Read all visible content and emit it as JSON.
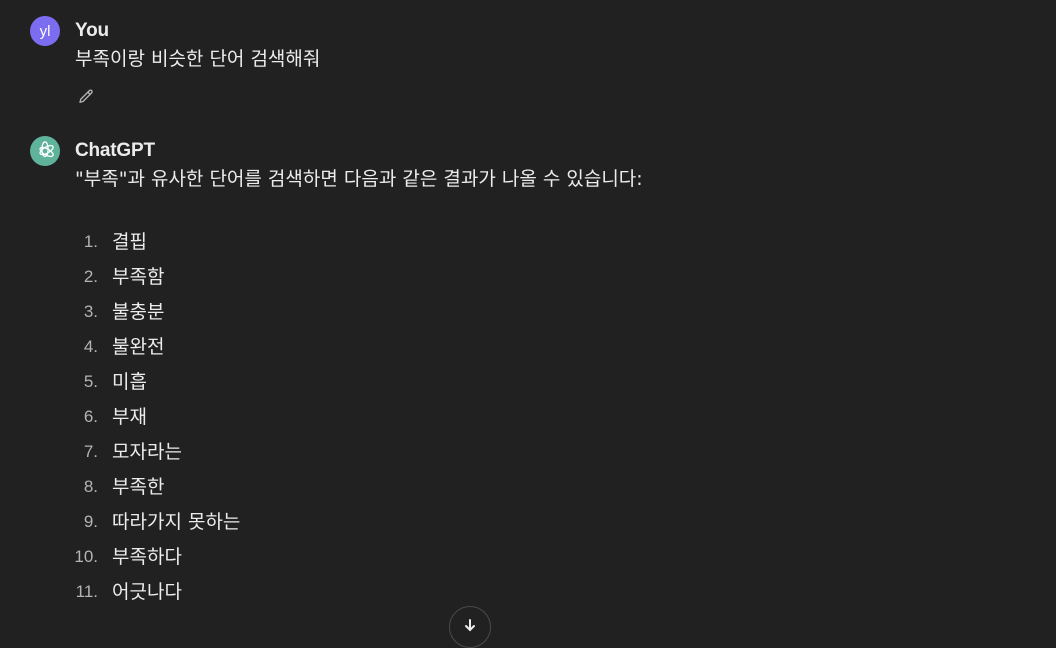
{
  "user_message": {
    "avatar_initials": "yl",
    "author": "You",
    "text": "부족이랑 비슷한 단어 검색해줘",
    "edit_icon": "pencil-icon"
  },
  "assistant_message": {
    "author": "ChatGPT",
    "avatar_icon": "openai-logo-icon",
    "intro": "\"부족\"과 유사한 단어를 검색하면 다음과 같은 결과가 나올 수 있습니다:",
    "items": [
      {
        "number": "1.",
        "text": "결핍"
      },
      {
        "number": "2.",
        "text": "부족함"
      },
      {
        "number": "3.",
        "text": "불충분"
      },
      {
        "number": "4.",
        "text": "불완전"
      },
      {
        "number": "5.",
        "text": "미흡"
      },
      {
        "number": "6.",
        "text": "부재"
      },
      {
        "number": "7.",
        "text": "모자라는"
      },
      {
        "number": "8.",
        "text": "부족한"
      },
      {
        "number": "9.",
        "text": "따라가지 못하는"
      },
      {
        "number": "10.",
        "text": "부족하다"
      },
      {
        "number": "11.",
        "text": "어긋나다"
      }
    ]
  },
  "scroll_button": {
    "icon": "arrow-down-icon"
  },
  "colors": {
    "background": "#212121",
    "text": "#ececec",
    "user_avatar": "#7c6df0",
    "bot_avatar": "#5fb39a"
  }
}
